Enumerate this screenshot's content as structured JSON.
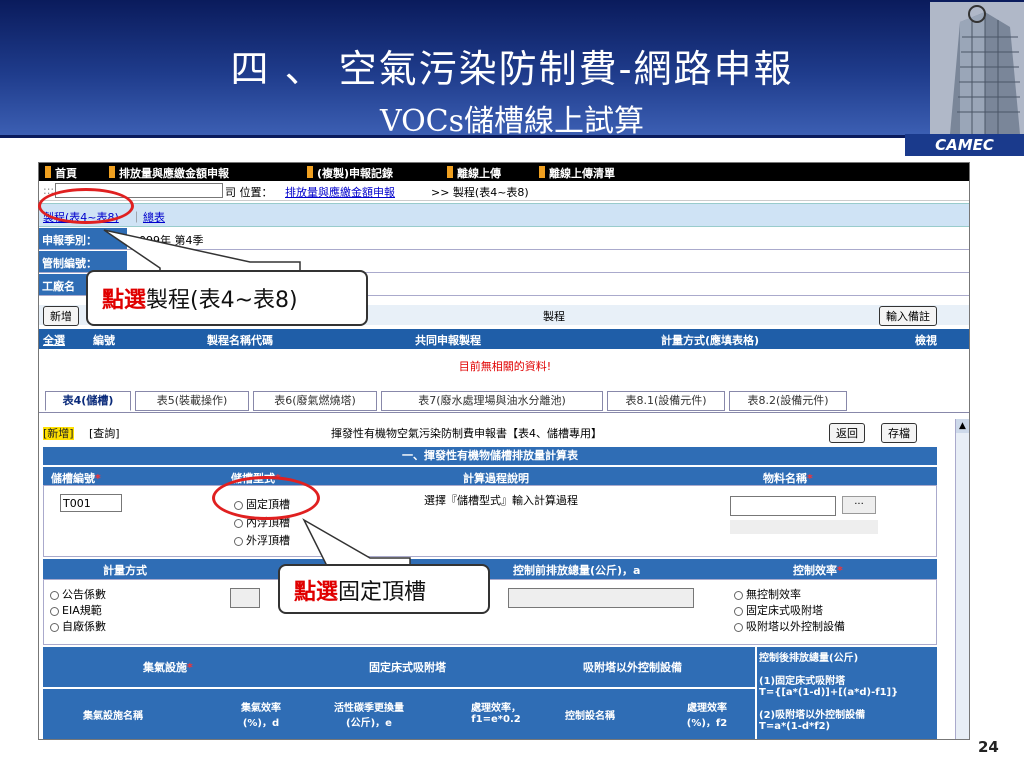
{
  "slide": {
    "title_line1": "四 、 空氣污染防制費-網路申報",
    "title_line2": "VOCs儲槽線上試算",
    "logo": "CAMEC",
    "page_number": "24"
  },
  "topnav": {
    "items": [
      "首頁",
      "排放量與應繳金額申報",
      "(複製)申報記錄",
      "離線上傳",
      "離線上傳清單"
    ]
  },
  "location": {
    "prefix": ":::",
    "suffix": "司 位置：",
    "link": "排放量與應繳金額申報",
    "rest": ">> 製程(表4~表8)"
  },
  "tabs1": {
    "process": "製程(表4~表8)",
    "sep": "｜",
    "summary": "總表"
  },
  "fields": {
    "season_label": "申報季別：",
    "season_value": "099年 第4季",
    "control_no_label": "管制編號：",
    "factory_label": "工廠名"
  },
  "process_bar": {
    "add": "新增",
    "title": "製程",
    "remark_btn": "輸入備註"
  },
  "process_table": {
    "headers": [
      "全選",
      "編號",
      "製程名稱代碼",
      "共同申報製程",
      "計量方式(應填表格)",
      "檢視"
    ],
    "empty_msg": "目前無相關的資料!"
  },
  "tabs2": [
    "表4(儲槽)",
    "表5(裝載操作)",
    "表6(廢氣燃燒塔)",
    "表7(廢水處理場與油水分離池)",
    "表8.1(設備元件)",
    "表8.2(設備元件)"
  ],
  "form": {
    "add": "[新增]",
    "query": "[查詢]",
    "title": "揮發性有機物空氣污染防制費申報書【表4、儲槽專用】",
    "back_btn": "返回",
    "save_btn": "存檔",
    "section1": "一、揮發性有機物儲槽排放量計算表",
    "col_tank_no": "儲槽編號",
    "col_tank_type": "儲槽型式",
    "col_calc_desc": "計算過程說明",
    "col_material": "物料名稱",
    "required": "*",
    "tank_no_value": "T001",
    "tank_types": [
      "固定頂槽",
      "內浮頂槽",
      "外浮頂槽"
    ],
    "calc_desc": "選擇『儲槽型式』輸入計算過程",
    "measure_label": "計量方式",
    "pre_control_label": "控制前排放總量(公斤)，a",
    "efficiency_label": "控制效率",
    "measure_options": [
      "公告係數",
      "EIA規範",
      "自廠係數"
    ],
    "efficiency_options": [
      "無控制效率",
      "固定床式吸附塔",
      "吸附塔以外控制設備"
    ],
    "collect_label": "集氣設施",
    "fixed_bed_label": "固定床式吸附塔",
    "other_ctrl_label": "吸附塔以外控制設備",
    "post_control_label": "控制後排放總量(公斤)",
    "formula1": "(1)固定床式吸附塔",
    "formula1b": "T={[a*(1-d)]+[(a*d)-f1]}",
    "formula2": "(2)吸附塔以外控制設備",
    "formula2b": "T=a*(1-d*f2)",
    "sub_headers": [
      "集氣設施名稱",
      "集氣效率\n(%)，d",
      "活性碳季更換量\n(公斤)，e",
      "處理效率，\nf1=e*0.2",
      "控制設名稱",
      "處理效率\n(%)，f2"
    ]
  },
  "callouts": {
    "c1_red": "點選",
    "c1_rest": "製程(表4~表8)",
    "c2_red": "點選",
    "c2_rest": "固定頂槽"
  },
  "colors": {
    "banner": "#1f3c8c",
    "header_blue": "#2f6db5",
    "highlight_red": "#e02020"
  }
}
